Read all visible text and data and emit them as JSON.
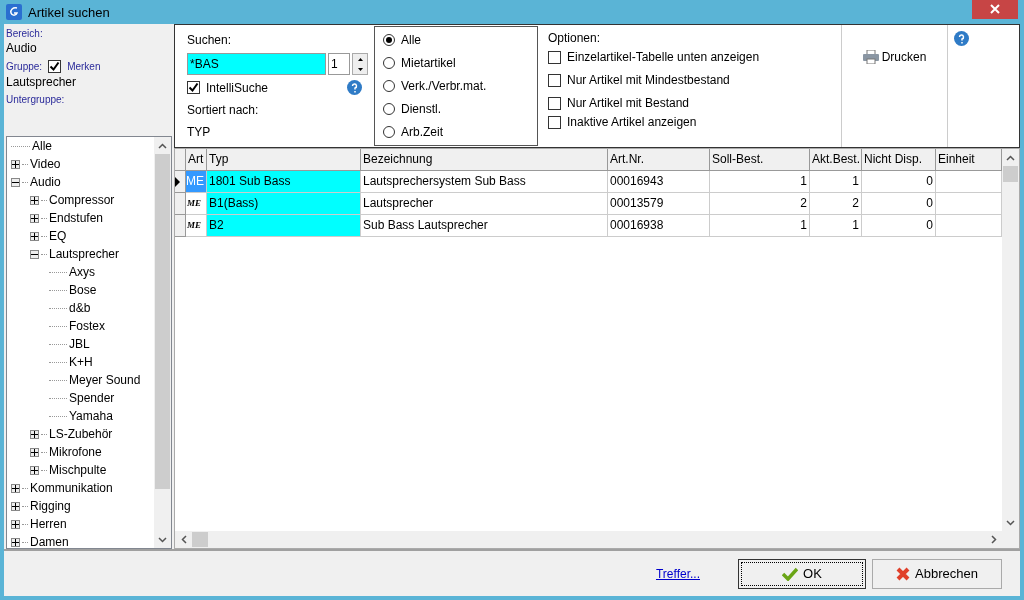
{
  "window": {
    "title": "Artikel suchen"
  },
  "left": {
    "bereich_label": "Bereich:",
    "bereich_value": "Audio",
    "gruppe_label": "Gruppe:",
    "merken": {
      "label": "Merken",
      "checked": true
    },
    "gruppe_value": "Lautsprecher",
    "untergruppe_label": "Untergruppe:",
    "tree": [
      {
        "label": "Alle"
      },
      {
        "label": "Video",
        "expanded": false
      },
      {
        "label": "Audio",
        "expanded": true,
        "children": [
          {
            "label": "Compressor",
            "expanded": false
          },
          {
            "label": "Endstufen",
            "expanded": false
          },
          {
            "label": "EQ",
            "expanded": false
          },
          {
            "label": "Lautsprecher",
            "expanded": true,
            "children": [
              {
                "label": "Axys"
              },
              {
                "label": "Bose"
              },
              {
                "label": "d&b"
              },
              {
                "label": "Fostex"
              },
              {
                "label": "JBL"
              },
              {
                "label": "K+H"
              },
              {
                "label": "Meyer Sound"
              },
              {
                "label": "Spender"
              },
              {
                "label": "Yamaha"
              }
            ]
          },
          {
            "label": "LS-Zubehör",
            "expanded": false
          },
          {
            "label": "Mikrofone",
            "expanded": false
          },
          {
            "label": "Mischpulte",
            "expanded": false
          }
        ]
      },
      {
        "label": "Kommunikation",
        "expanded": false
      },
      {
        "label": "Rigging",
        "expanded": false
      },
      {
        "label": "Herren",
        "expanded": false
      },
      {
        "label": "Damen",
        "expanded": false
      }
    ]
  },
  "search": {
    "label": "Suchen:",
    "value": "*BAS",
    "spin_value": "1",
    "intellisuche": {
      "label": "IntelliSuche",
      "checked": true
    },
    "sort_label": "Sortiert nach:",
    "sort_value": "TYP"
  },
  "article_types": [
    {
      "label": "Alle",
      "selected": true
    },
    {
      "label": "Mietartikel",
      "selected": false
    },
    {
      "label": "Verk./Verbr.mat.",
      "selected": false
    },
    {
      "label": "Dienstl.",
      "selected": false
    },
    {
      "label": "Arb.Zeit",
      "selected": false
    }
  ],
  "options": {
    "title": "Optionen:",
    "items": [
      {
        "label": "Einzelartikel-Tabelle unten anzeigen",
        "checked": false
      },
      {
        "label": "Nur Artikel mit Mindestbestand",
        "checked": false
      },
      {
        "label": "Nur Artikel mit Bestand",
        "checked": false
      },
      {
        "label": "Inaktive Artikel anzeigen",
        "checked": false
      }
    ]
  },
  "print_button": "Drucken",
  "table": {
    "columns": [
      "Art",
      "Typ",
      "Bezeichnung",
      "Art.Nr.",
      "Soll-Best.",
      "Akt.Best.",
      "Nicht Disp.",
      "Einheit"
    ],
    "rows": [
      {
        "selected": true,
        "cells": [
          "ME",
          "1801 Sub Bass",
          "Lautsprechersystem Sub Bass",
          "00016943",
          "1",
          "1",
          "0"
        ]
      },
      {
        "selected": false,
        "cells": [
          "ME",
          "B1(Bass)",
          "Lautsprecher",
          "00013579",
          "2",
          "2",
          "0"
        ]
      },
      {
        "selected": false,
        "cells": [
          "ME",
          "B2",
          "Sub Bass Lautsprecher",
          "00016938",
          "1",
          "1",
          "0"
        ]
      }
    ]
  },
  "footer": {
    "link": "Treffer...",
    "ok": "OK",
    "cancel": "Abbrechen"
  }
}
